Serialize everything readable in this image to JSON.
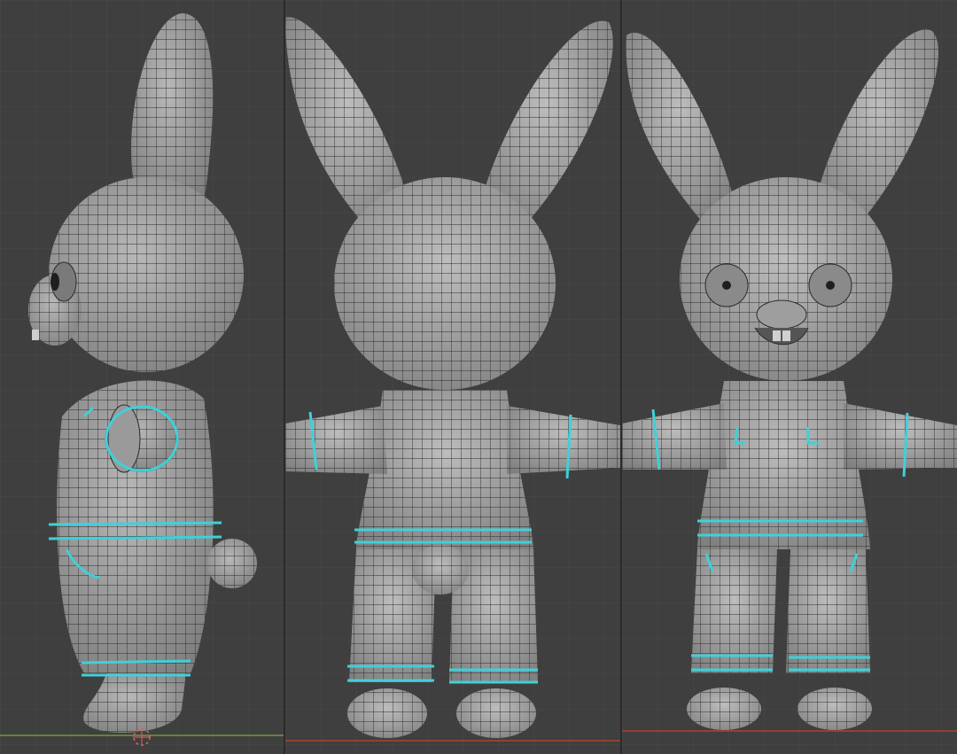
{
  "viewport": {
    "background": "#3f3f3f",
    "grid_color": "#4a4a4a",
    "floor_line_color": "#b0402f",
    "y_axis_color": "#6e9a3a"
  },
  "mesh": {
    "body_color": "#a9a9a9",
    "body_shade": "#8b8b8b",
    "wire_color": "#2b2b2b",
    "seam_color": "#3fd0d8",
    "dark_color": "#1f1f1f"
  },
  "panels": [
    {
      "view": "side"
    },
    {
      "view": "back"
    },
    {
      "view": "front"
    }
  ],
  "origin_marker": {
    "color": "#e06060"
  }
}
